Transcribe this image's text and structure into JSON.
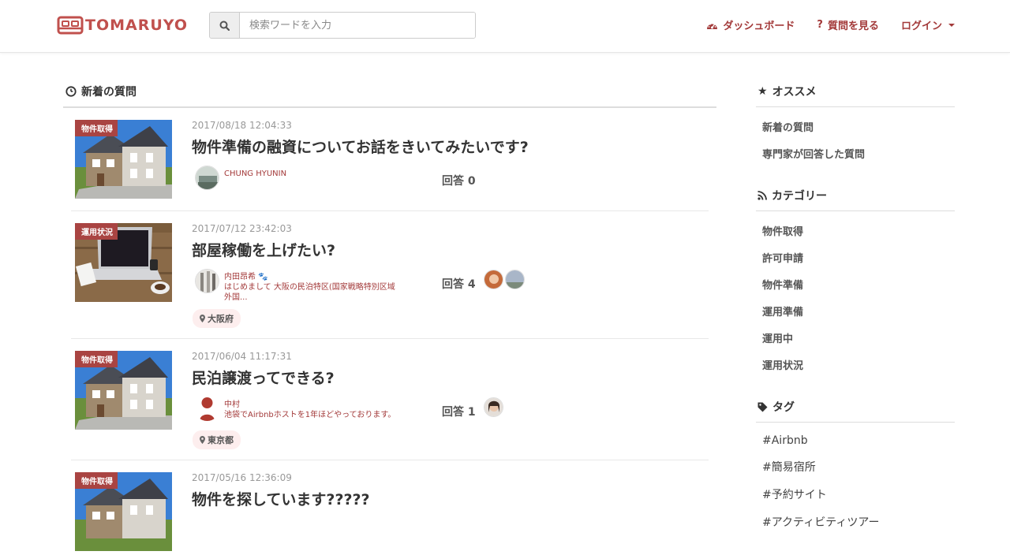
{
  "brand": {
    "name": "TOMARUYO"
  },
  "search": {
    "placeholder": "検索ワードを入力"
  },
  "nav": {
    "dashboard": "ダッシュボード",
    "questions": "質問を見る",
    "login": "ログイン"
  },
  "main": {
    "heading": "新着の質問",
    "questions": [
      {
        "category": "物件取得",
        "date": "2017/08/18 12:04:33",
        "title": "物件準備の融資についてお話をきいてみたいです?",
        "user_name": "CHUNG HYUNIN",
        "user_bio": "",
        "answer_label": "回答 0",
        "location": ""
      },
      {
        "category": "運用状況",
        "date": "2017/07/12 23:42:03",
        "title": "部屋稼働を上げたい?",
        "user_name": "内田昂希",
        "user_bio": "はじめまして 大阪の民泊特区(国家戦略特別区域外国...",
        "answer_label": "回答 4",
        "location": "大阪府"
      },
      {
        "category": "物件取得",
        "date": "2017/06/04 11:17:31",
        "title": "民泊譲渡ってできる?",
        "user_name": "中村",
        "user_bio": "池袋でAirbnbホストを1年ほどやっております。",
        "answer_label": "回答 1",
        "location": "東京都"
      },
      {
        "category": "物件取得",
        "date": "2017/05/16 12:36:09",
        "title": "物件を探しています?????",
        "user_name": "",
        "user_bio": "",
        "answer_label": "",
        "location": ""
      }
    ]
  },
  "sidebar": {
    "recommend": {
      "heading": "オススメ",
      "items": [
        "新着の質問",
        "専門家が回答した質問"
      ]
    },
    "categories": {
      "heading": "カテゴリー",
      "items": [
        "物件取得",
        "許可申請",
        "物件準備",
        "運用準備",
        "運用中",
        "運用状況"
      ]
    },
    "tags": {
      "heading": "タグ",
      "items": [
        "#Airbnb",
        "#簡易宿所",
        "#予約サイト",
        "#アクティビティツアー"
      ]
    }
  },
  "colors": {
    "brand": "#c0504d",
    "link": "#a33a3a",
    "category_badge": "#a94442",
    "location_bg": "#fdeeee"
  }
}
